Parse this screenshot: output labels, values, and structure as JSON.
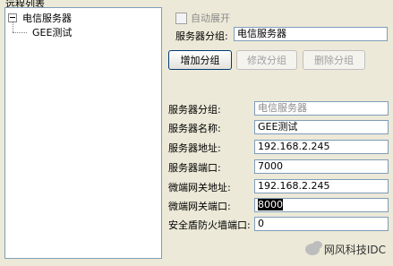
{
  "panel": {
    "title": "远程列表"
  },
  "tree": {
    "root_label": "电信服务器",
    "child_label": "GEE测试"
  },
  "auto_expand": {
    "label": "自动展开",
    "checked": false
  },
  "group_edit": {
    "label": "服务器分组:",
    "value": "电信服务器"
  },
  "buttons": {
    "add_group": "增加分组",
    "edit_group": "修改分组",
    "delete_group": "删除分组"
  },
  "details": {
    "group": {
      "label": "服务器分组:",
      "value": "电信服务器"
    },
    "name": {
      "label": "服务器名称:",
      "value": "GEE测试"
    },
    "address": {
      "label": "服务器地址:",
      "value": "192.168.2.245"
    },
    "port": {
      "label": "服务器端口:",
      "value": "7000"
    },
    "gateway_address": {
      "label": "微端网关地址:",
      "value": "192.168.2.245"
    },
    "gateway_port": {
      "label": "微端网关端口:",
      "value": "8000"
    },
    "firewall_port": {
      "label": "安全盾防火墙端口:",
      "value": "0"
    }
  },
  "watermark": {
    "text": "网风科技IDC",
    "icon": "wechat-icon"
  }
}
